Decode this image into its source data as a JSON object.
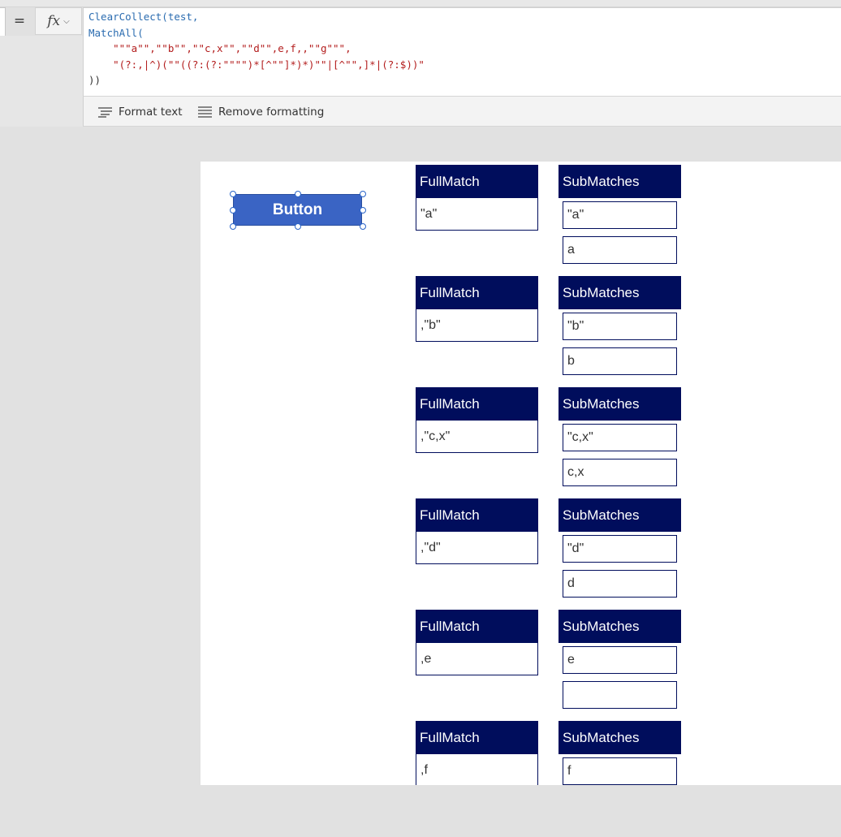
{
  "formula_bar": {
    "equals": "=",
    "fx_label": "fx",
    "chevron": "⌵",
    "code_lines": [
      {
        "t": "fn",
        "v": "ClearCollect(test,"
      },
      {
        "t": "fn",
        "v": "MatchAll("
      },
      {
        "t": "str",
        "v": "    \"\"\"a\"\",\"\"b\"\",\"\"c,x\"\",\"\"d\"\",e,f,,\"\"g\"\"\","
      },
      {
        "t": "str",
        "v": "    \"(?:,|^)(\"\"((?:(?:\"\"\"\")*[^\"\"]*)*)\"\"|[^\"\",]*|(?:$))\""
      },
      {
        "t": "punc",
        "v": "))"
      }
    ],
    "format_text_label": "Format text",
    "remove_formatting_label": "Remove formatting",
    "format_icon": "format-text-icon",
    "remove_icon": "remove-formatting-icon"
  },
  "canvas": {
    "button_label": "Button",
    "groups": [
      {
        "full_header": "FullMatch",
        "full_value": "\"a\"",
        "sub_header": "SubMatches",
        "sub_values": [
          "\"a\"",
          "a"
        ]
      },
      {
        "full_header": "FullMatch",
        "full_value": ",\"b\"",
        "sub_header": "SubMatches",
        "sub_values": [
          "\"b\"",
          "b"
        ]
      },
      {
        "full_header": "FullMatch",
        "full_value": ",\"c,x\"",
        "sub_header": "SubMatches",
        "sub_values": [
          "\"c,x\"",
          "c,x"
        ]
      },
      {
        "full_header": "FullMatch",
        "full_value": ",\"d\"",
        "sub_header": "SubMatches",
        "sub_values": [
          "\"d\"",
          "d"
        ]
      },
      {
        "full_header": "FullMatch",
        "full_value": ",e",
        "sub_header": "SubMatches",
        "sub_values": [
          "e",
          ""
        ]
      },
      {
        "full_header": "FullMatch",
        "full_value": ",f",
        "sub_header": "SubMatches",
        "sub_values": [
          "f"
        ]
      }
    ]
  },
  "colors": {
    "header_bg": "#000d5c",
    "button_bg": "#3a64c4",
    "string_red": "#b31d1d",
    "function_blue": "#2b6cb0"
  }
}
